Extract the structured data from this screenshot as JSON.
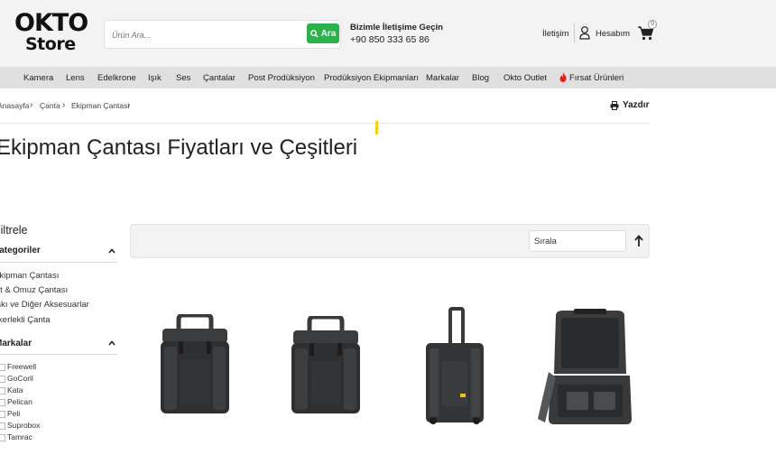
{
  "header": {
    "logo_line1": "OKTO",
    "logo_line2": "Store",
    "search_placeholder": "Ürün Ara...",
    "search_button": "Ara",
    "contact_title": "Bizimle İletişime Geçin",
    "contact_phone": "+90 850 333 65 86",
    "contact_link": "İletişim",
    "account_link": "Hesabım",
    "cart_count": "0"
  },
  "nav": {
    "items": [
      "Kamera",
      "Lens",
      "Edelkrone",
      "Işık",
      "Ses",
      "Çantalar",
      "Post Prodüksiyon",
      "Prodüksiyon Ekipmanları",
      "Markalar",
      "Blog",
      "Okto Outlet",
      "Fırsat Ürünleri"
    ]
  },
  "breadcrumb": {
    "items": [
      "Anasayfa",
      "Çanta",
      "Ekipman Çantası"
    ],
    "separator": "›",
    "print_label": "Yazdır"
  },
  "page_title": "Ekipman Çantası Fiyatları ve Çeşitleri",
  "sidebar": {
    "filter_title": "Filtrele",
    "categories_title": "Kategoriler",
    "categories": [
      "Ekipman Çantası",
      "Sırt & Omuz Çantası",
      "Askı ve Diğer Aksesuarlar",
      "Tekerlekli Çanta"
    ],
    "brands_title": "Markalar",
    "brands": [
      "Freewell",
      "GoCoril",
      "Kata",
      "Pelican",
      "Peli",
      "Suprobox",
      "Tamrac"
    ]
  },
  "sort": {
    "label": "Sırala"
  },
  "products": [
    {
      "icon": "hard-case-icon"
    },
    {
      "icon": "hard-case-icon"
    },
    {
      "icon": "trolley-case-icon"
    },
    {
      "icon": "open-case-icon"
    }
  ],
  "colors": {
    "accent_green": "#2bb24c",
    "header_bg": "#f3f3f3",
    "nav_bg": "#e0e0e0",
    "fire_red": "#d9261c",
    "marker_yellow": "#f2d21b"
  }
}
